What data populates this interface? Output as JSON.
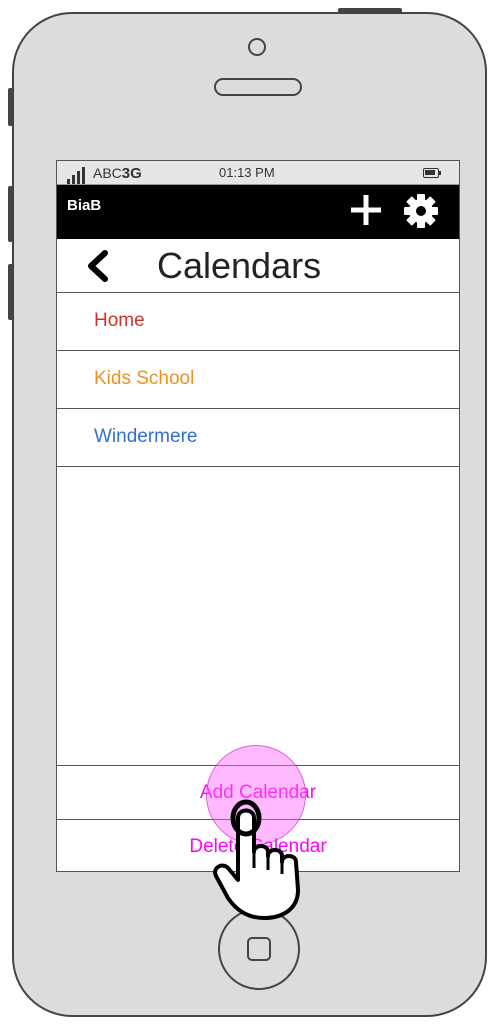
{
  "status_bar": {
    "carrier_prefix": "ABC",
    "carrier_network": "3G",
    "time": "01:13 PM"
  },
  "app_bar": {
    "title": "BiaB",
    "actions": [
      "plus-icon",
      "gear-icon"
    ]
  },
  "header": {
    "title": "Calendars",
    "back_icon": "chevron-left-icon"
  },
  "calendars": [
    {
      "label": "Home",
      "color": "#d0312d"
    },
    {
      "label": "Kids School",
      "color": "#f0901e"
    },
    {
      "label": "Windermere",
      "color": "#2f6fd6"
    }
  ],
  "actions": {
    "add_label": "Add Calendar",
    "delete_label": "Delete Calendar",
    "color": "#ff00ff"
  },
  "colors": {
    "app_bar_bg": "#000000",
    "touch_highlight": "#ff66ff"
  }
}
